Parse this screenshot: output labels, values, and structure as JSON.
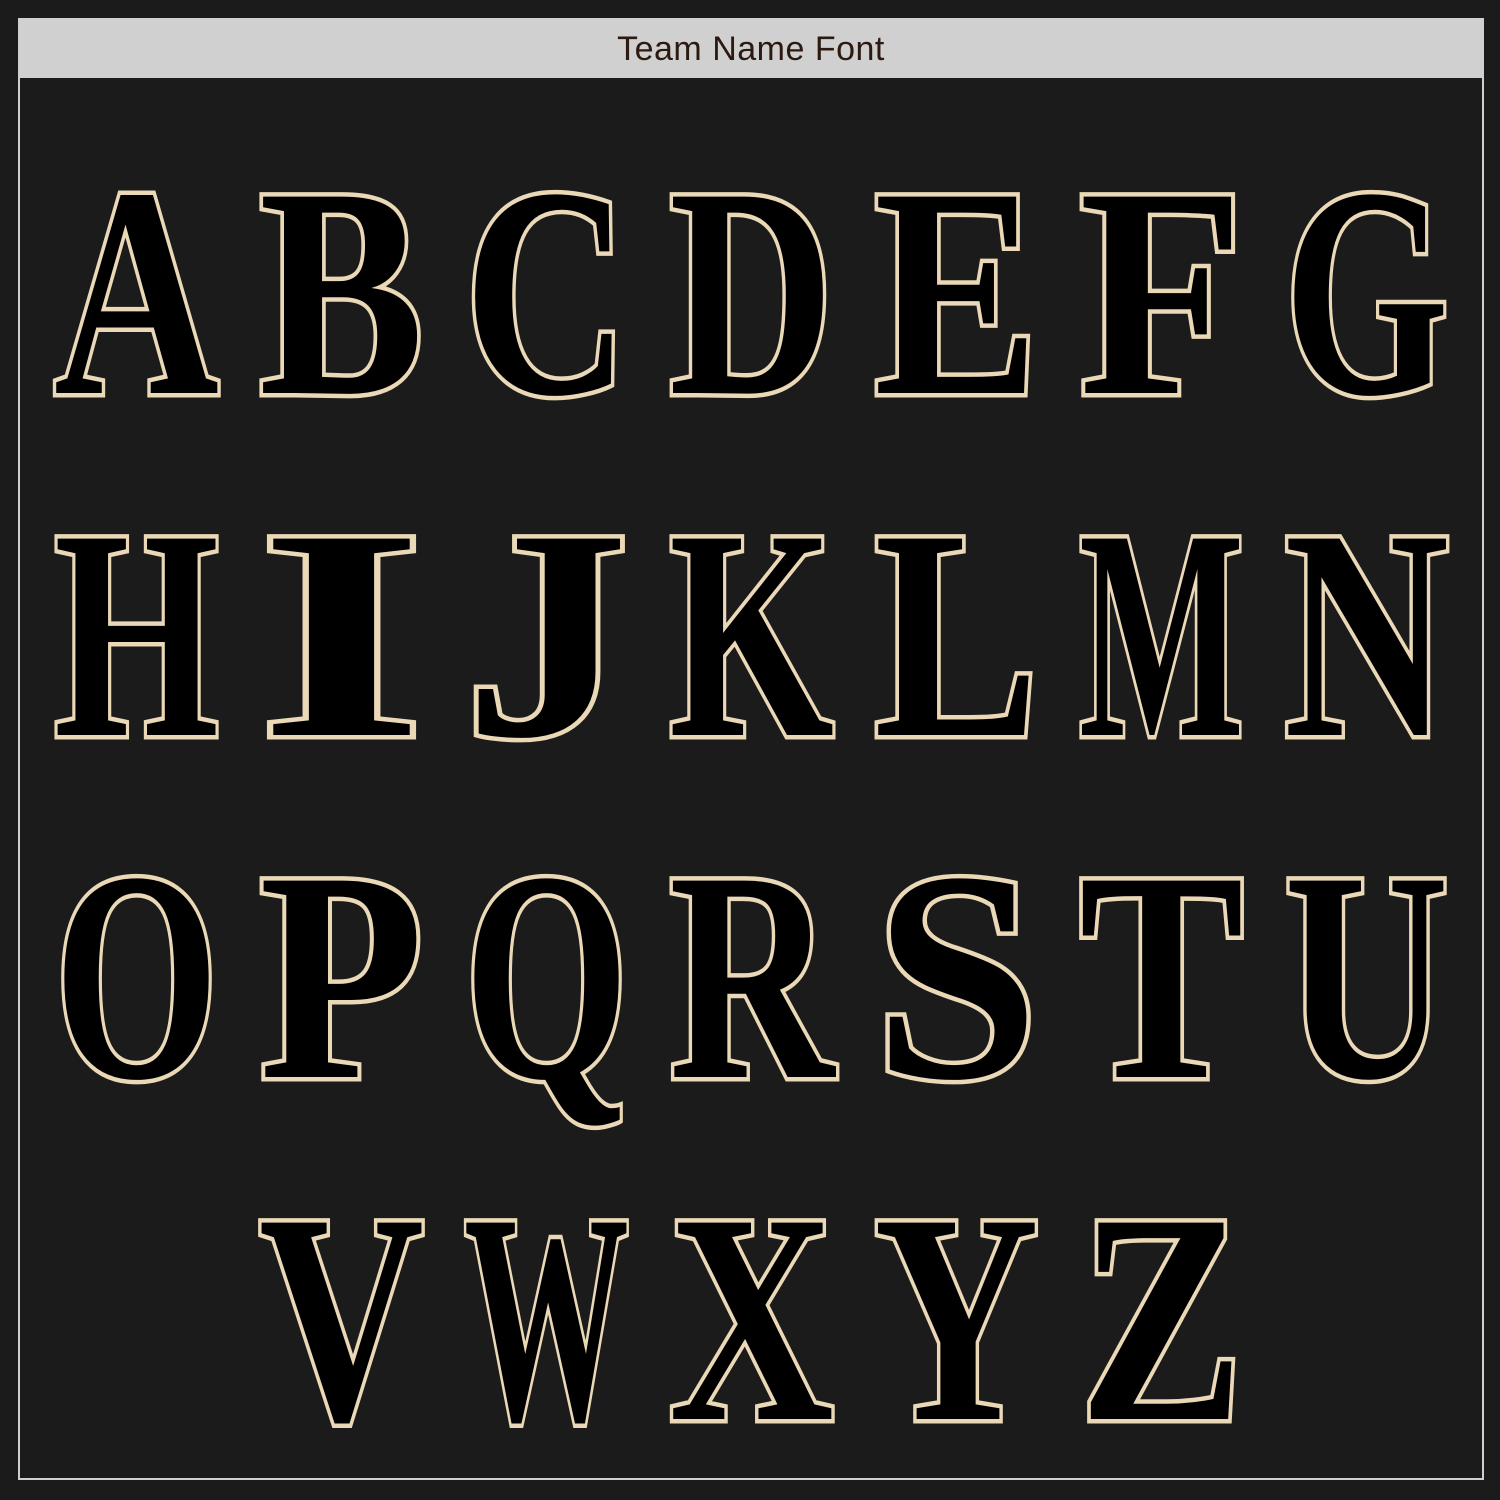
{
  "header": {
    "title": "Team Name Font"
  },
  "colors": {
    "background": "#1b1b1b",
    "header_background": "#d0d0d0",
    "header_text": "#2c1a10",
    "letter_fill": "#000000",
    "letter_outline": "#ead8b6"
  },
  "rows": [
    [
      "A",
      "B",
      "C",
      "D",
      "E",
      "F",
      "G"
    ],
    [
      "H",
      "I",
      "J",
      "K",
      "L",
      "M",
      "N"
    ],
    [
      "O",
      "P",
      "Q",
      "R",
      "S",
      "T",
      "U"
    ],
    [
      "V",
      "W",
      "X",
      "Y",
      "Z"
    ]
  ]
}
